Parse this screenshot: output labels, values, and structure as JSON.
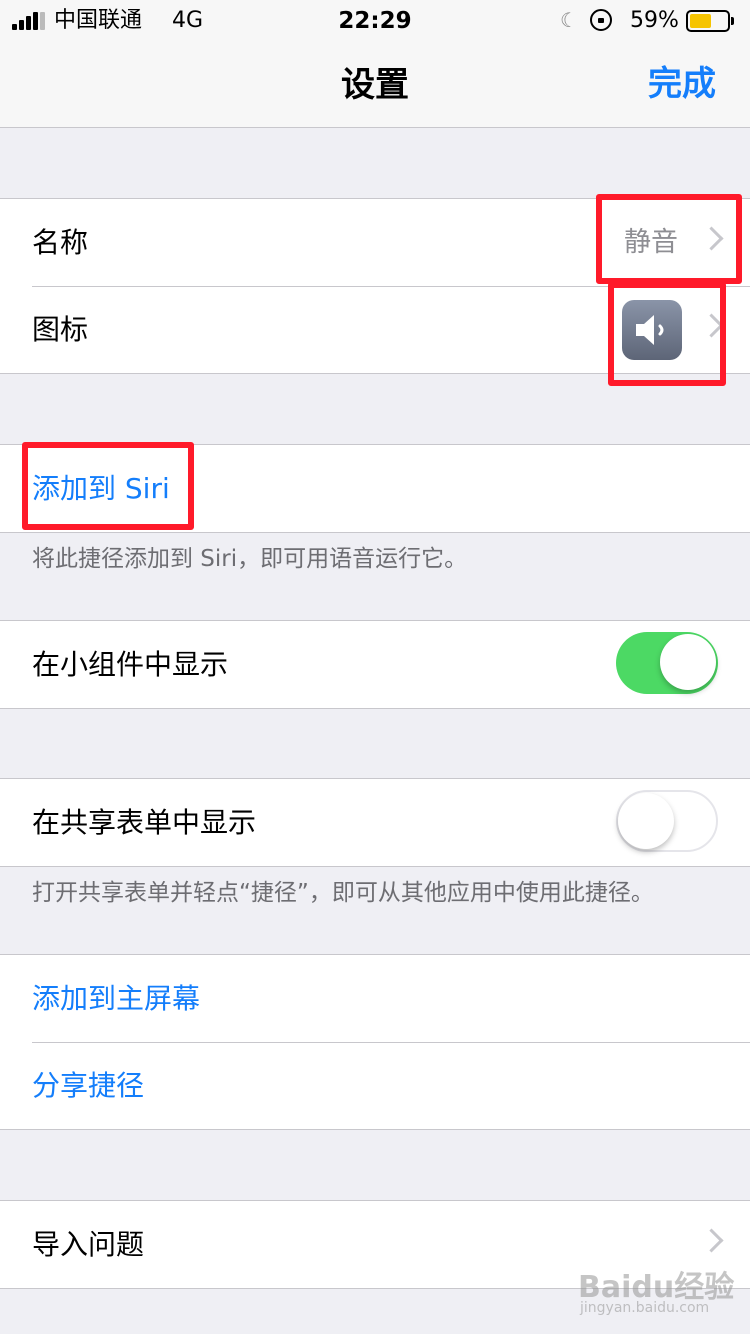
{
  "status_bar": {
    "carrier": "中国联通",
    "network": "4G",
    "time": "22:29",
    "battery_percent_text": "59%",
    "battery_level": 0.59,
    "battery_color": "#f6c400"
  },
  "nav": {
    "title": "设置",
    "done_label": "完成"
  },
  "group_info": {
    "name_label": "名称",
    "name_value": "静音",
    "icon_label": "图标",
    "icon_name": "speaker-mute-icon"
  },
  "siri": {
    "add_label": "添加到 Siri",
    "note": "将此捷径添加到 Siri，即可用语音运行它。"
  },
  "widget": {
    "label": "在小组件中显示",
    "enabled": true
  },
  "share_sheet": {
    "label": "在共享表单中显示",
    "enabled": false,
    "note": "打开共享表单并轻点“捷径”，即可从其他应用中使用此捷径。"
  },
  "actions": {
    "add_home_label": "添加到主屏幕",
    "share_label": "分享捷径"
  },
  "import": {
    "label": "导入问题"
  },
  "watermark": {
    "brand": "Baidu经验",
    "url": "jingyan.baidu.com"
  },
  "colors": {
    "accent": "#147efb",
    "toggle_on": "#4cd964",
    "annotation": "#ff1a2a"
  }
}
